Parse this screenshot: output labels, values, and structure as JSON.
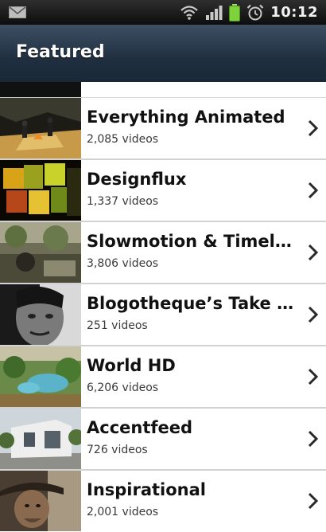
{
  "status_bar": {
    "time": "10:12",
    "icons": [
      "mail-icon",
      "wifi-icon",
      "signal-icon",
      "battery-icon",
      "alarm-icon"
    ]
  },
  "header": {
    "title": "Featured"
  },
  "channels": [
    {
      "title": "Everything Animated",
      "subtitle": "2,085 videos"
    },
    {
      "title": "Designflux",
      "subtitle": "1,337 videos"
    },
    {
      "title": "Slowmotion & Timelap…",
      "subtitle": "3,806 videos"
    },
    {
      "title": "Blogotheque’s Take A…",
      "subtitle": "251 videos"
    },
    {
      "title": "World HD",
      "subtitle": "6,206 videos"
    },
    {
      "title": "Accentfeed",
      "subtitle": "726 videos"
    },
    {
      "title": "Inspirational",
      "subtitle": "2,001 videos"
    }
  ],
  "colors": {
    "header_top": "#3d4f63",
    "header_bottom": "#1a2836",
    "battery": "#7fd33a",
    "chevron": "#2a2a2a"
  }
}
